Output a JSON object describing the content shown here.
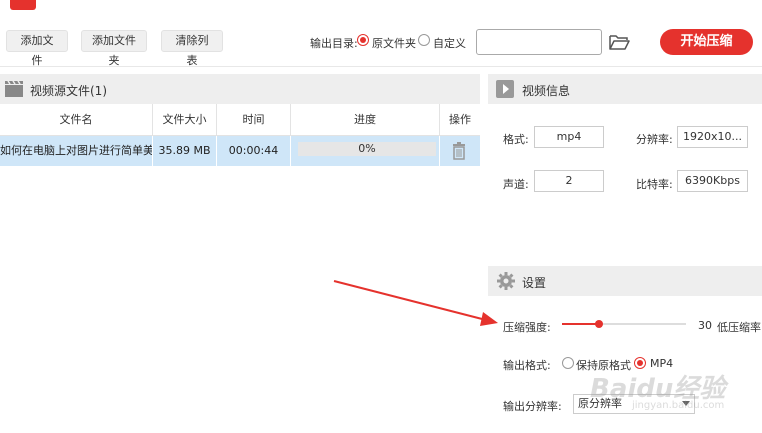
{
  "app": {
    "title": ""
  },
  "toolbar": {
    "add_file": "添加文件",
    "add_folder": "添加文件夹",
    "clear_list": "清除列表",
    "output_dir_label": "输出目录:",
    "radio_original": "原文件夹",
    "radio_custom": "自定义",
    "path_value": "",
    "start_label": "开始压缩"
  },
  "source_panel": {
    "title": "视频源文件(1)",
    "columns": [
      "文件名",
      "文件大小",
      "时间",
      "进度",
      "操作"
    ],
    "rows": [
      {
        "name": "如何在电脑上对图片进行简单美...",
        "size": "35.89 MB",
        "time": "00:00:44",
        "progress_text": "0%",
        "progress": 0
      }
    ]
  },
  "video_info": {
    "title": "视频信息",
    "format_label": "格式:",
    "format_value": "mp4",
    "resolution_label": "分辨率:",
    "resolution_value": "1920x10...",
    "channels_label": "声道:",
    "channels_value": "2",
    "bitrate_label": "比特率:",
    "bitrate_value": "6390Kbps"
  },
  "settings": {
    "title": "设置",
    "strength_label": "压缩强度:",
    "strength_value": "30",
    "strength_percent": 30,
    "strength_desc": "低压缩率",
    "output_format_label": "输出格式:",
    "keep_format": "保持原格式",
    "mp4": "MP4",
    "output_res_label": "输出分辨率:",
    "output_res_value": "原分辨率"
  },
  "watermark": {
    "brand": "Baidu经验",
    "url": "jingyan.baidu.com"
  },
  "colors": {
    "accent": "#e5322d",
    "selected_row": "#cfe6f8",
    "panel_header": "#eeeeee"
  }
}
